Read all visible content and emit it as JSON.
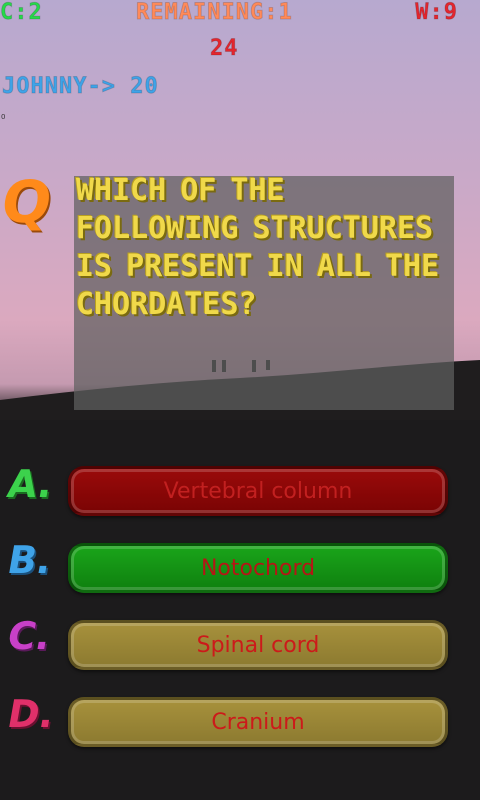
{
  "hud": {
    "correct": "C:2",
    "remaining": "REMAINING:1",
    "wrong": "W:9",
    "timer": "24",
    "player": "JOHNNY-> 20",
    "tiny": "0"
  },
  "question": {
    "marker": "Q",
    "text": "Which of the following structures is present in all the chordates?"
  },
  "answers": [
    {
      "letter": "A.",
      "text": "Vertebral column",
      "state": "wrong",
      "color": "#8b0606"
    },
    {
      "letter": "B.",
      "text": "Notochord",
      "state": "correct",
      "color": "#169416"
    },
    {
      "letter": "C.",
      "text": "Spinal cord",
      "state": "default",
      "color": "#9a8636"
    },
    {
      "letter": "D.",
      "text": "Cranium",
      "state": "default",
      "color": "#9a8636"
    }
  ]
}
